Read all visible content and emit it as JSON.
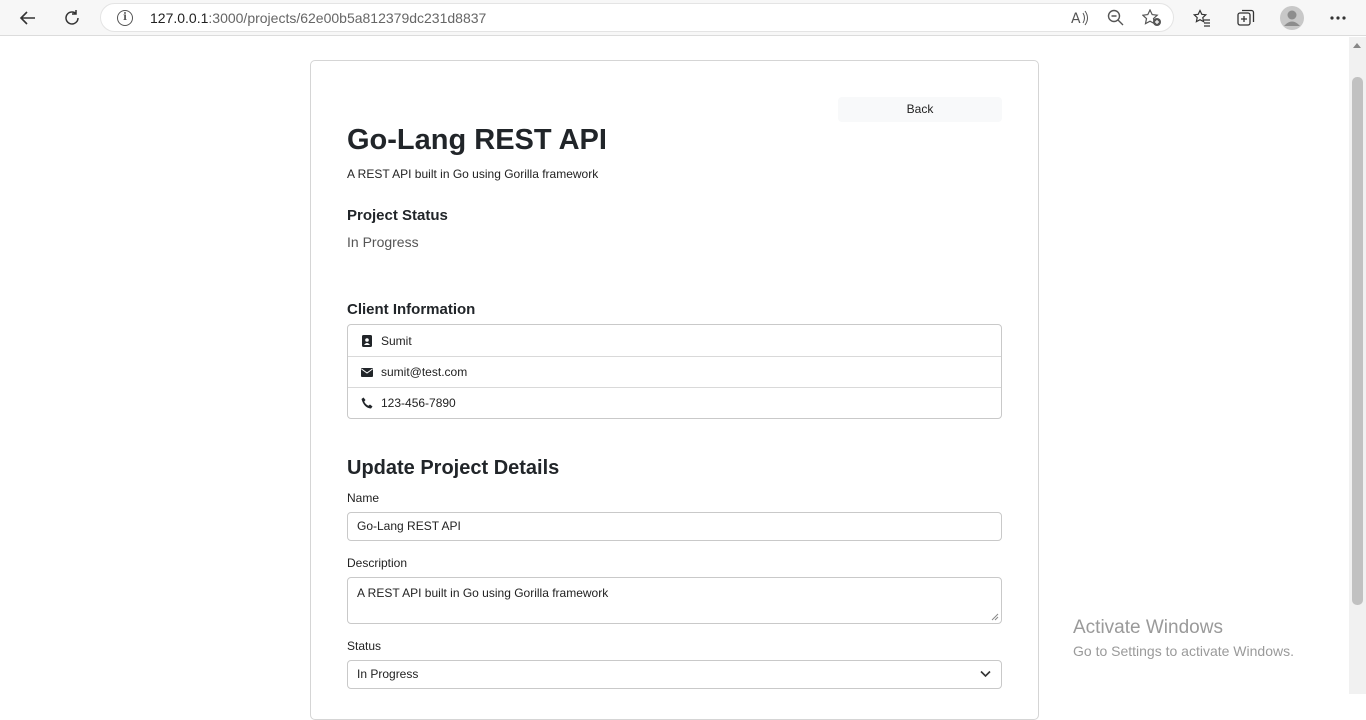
{
  "browser": {
    "url_host": "127.0.0.1",
    "url_rest": ":3000/projects/62e00b5a812379dc231d8837",
    "icons": [
      "back-arrow-icon",
      "refresh-icon",
      "info-icon",
      "read-aloud-icon",
      "zoom-out-icon",
      "add-favorite-icon",
      "favorites-icon",
      "collections-icon",
      "profile-icon",
      "more-icon"
    ]
  },
  "project": {
    "back_label": "Back",
    "title": "Go-Lang REST API",
    "description": "A REST API built in Go using Gorilla framework",
    "status_heading": "Project Status",
    "status": "In Progress"
  },
  "client": {
    "heading": "Client Information",
    "name": "Sumit",
    "email": "sumit@test.com",
    "phone": "123-456-7890"
  },
  "form": {
    "heading": "Update Project Details",
    "name_label": "Name",
    "name_value": "Go-Lang REST API",
    "description_label": "Description",
    "description_value": "A REST API built in Go using Gorilla framework",
    "status_label": "Status",
    "status_value": "In Progress"
  },
  "watermark": {
    "line1": "Activate Windows",
    "line2": "Go to Settings to activate Windows."
  }
}
